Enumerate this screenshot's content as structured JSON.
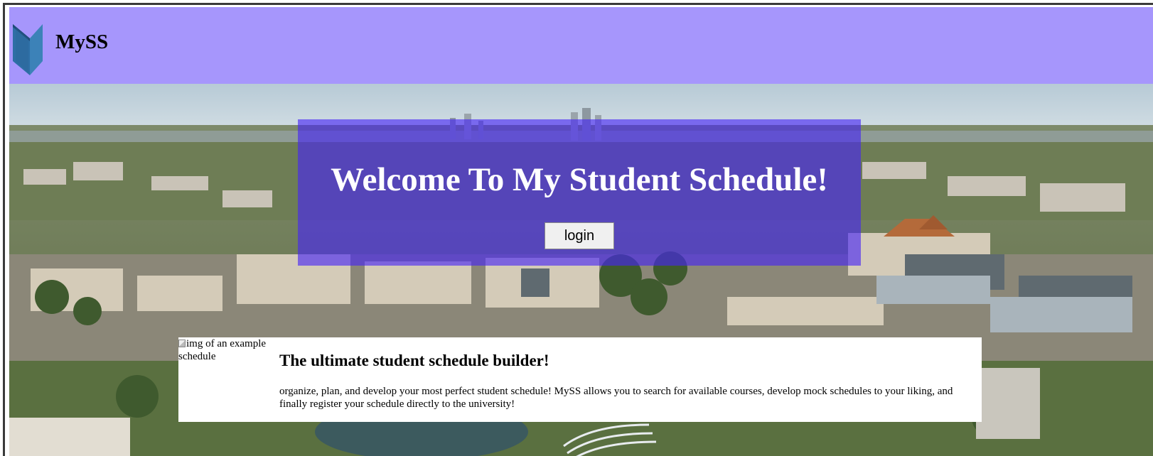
{
  "header": {
    "brand": "MySS",
    "background_color": "#a696fc",
    "logo_icon": "book-icon",
    "logo_colors": [
      "#1f4a78",
      "#2e6fa6",
      "#3c82b8"
    ]
  },
  "hero": {
    "background": "campus-aerial-photo",
    "panel_color": "rgba(70,35,245,0.62)",
    "title": "Welcome To My Student Schedule!",
    "login_label": "login"
  },
  "info_card": {
    "image_alt": "img of an example schedule",
    "title": "The ultimate student schedule builder!",
    "description": "organize, plan, and develop your most perfect student schedule! MySS allows you to search for available courses, develop mock schedules to your liking, and finally register your schedule directly to the university!"
  }
}
